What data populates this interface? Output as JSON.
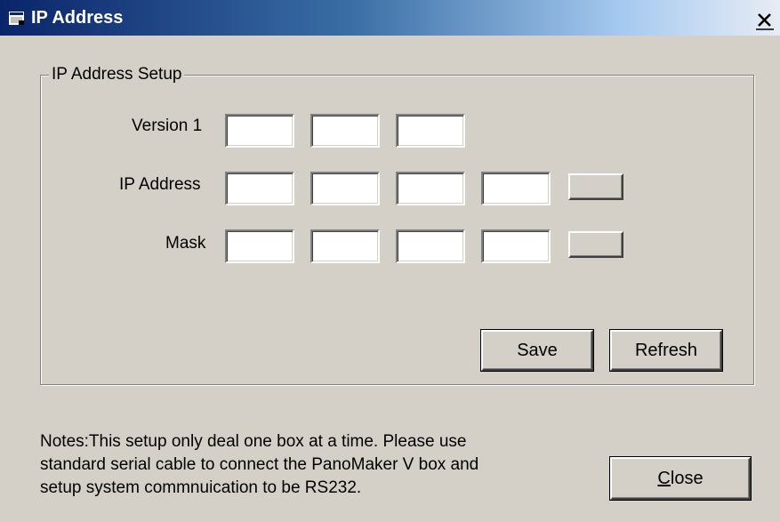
{
  "window": {
    "title": "IP Address",
    "close_glyph": "✕"
  },
  "group": {
    "legend": "IP Address Setup"
  },
  "rows": {
    "version": {
      "label": "Version 1",
      "fields": [
        "",
        "",
        ""
      ]
    },
    "ip": {
      "label": "IP Address",
      "fields": [
        "",
        "",
        "",
        ""
      ],
      "button_label": ""
    },
    "mask": {
      "label": "Mask",
      "fields": [
        "",
        "",
        "",
        ""
      ],
      "button_label": ""
    }
  },
  "buttons": {
    "save": "Save",
    "refresh": "Refresh",
    "close_mnemonic": "C",
    "close_rest": "lose"
  },
  "notes": {
    "lines": [
      "Notes:This setup only deal one box at a time. Please use",
      "standard serial cable to connect the PanoMaker V box and",
      "setup system commnuication to be RS232."
    ]
  },
  "icons": {
    "title_icon": "app-window-icon",
    "close_icon": "close-icon"
  }
}
